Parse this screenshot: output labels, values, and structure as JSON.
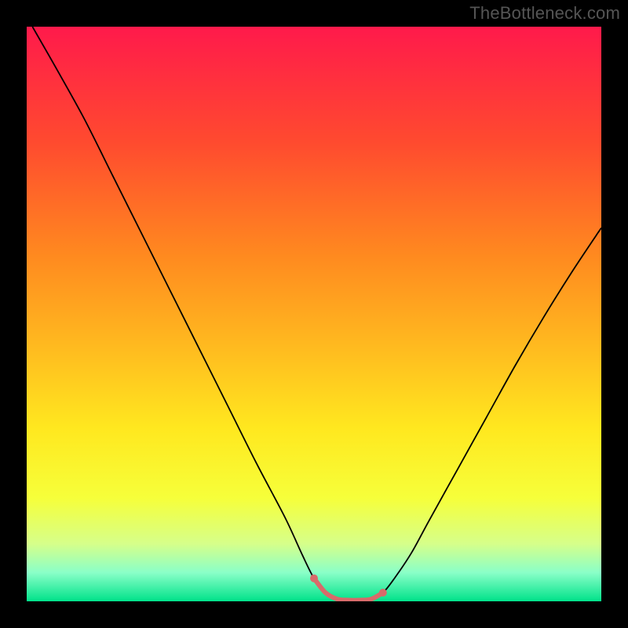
{
  "watermark": "TheBottleneck.com",
  "chart_data": {
    "type": "line",
    "title": "",
    "xlabel": "",
    "ylabel": "",
    "xlim": [
      0,
      100
    ],
    "ylim": [
      0,
      100
    ],
    "gradient_stops": [
      {
        "offset": 0,
        "color": "#ff1a4b"
      },
      {
        "offset": 20,
        "color": "#ff4a2f"
      },
      {
        "offset": 40,
        "color": "#ff8a1f"
      },
      {
        "offset": 55,
        "color": "#ffb81f"
      },
      {
        "offset": 70,
        "color": "#ffe81f"
      },
      {
        "offset": 82,
        "color": "#f6ff3a"
      },
      {
        "offset": 90,
        "color": "#d6ff8a"
      },
      {
        "offset": 95,
        "color": "#8affc8"
      },
      {
        "offset": 100,
        "color": "#00e28a"
      }
    ],
    "series": [
      {
        "name": "bottleneck-curve",
        "stroke": "#000000",
        "points": [
          {
            "x": 1.0,
            "y": 100.0
          },
          {
            "x": 5.0,
            "y": 93.0
          },
          {
            "x": 10.0,
            "y": 84.0
          },
          {
            "x": 15.0,
            "y": 74.0
          },
          {
            "x": 20.0,
            "y": 64.0
          },
          {
            "x": 25.0,
            "y": 54.0
          },
          {
            "x": 30.0,
            "y": 44.0
          },
          {
            "x": 35.0,
            "y": 34.0
          },
          {
            "x": 40.0,
            "y": 24.0
          },
          {
            "x": 45.0,
            "y": 14.5
          },
          {
            "x": 48.0,
            "y": 8.0
          },
          {
            "x": 50.0,
            "y": 4.0
          },
          {
            "x": 52.0,
            "y": 1.5
          },
          {
            "x": 54.0,
            "y": 0.4
          },
          {
            "x": 56.0,
            "y": 0.2
          },
          {
            "x": 58.0,
            "y": 0.2
          },
          {
            "x": 60.0,
            "y": 0.4
          },
          {
            "x": 62.0,
            "y": 1.5
          },
          {
            "x": 64.0,
            "y": 4.0
          },
          {
            "x": 67.0,
            "y": 8.5
          },
          {
            "x": 70.0,
            "y": 14.0
          },
          {
            "x": 75.0,
            "y": 23.0
          },
          {
            "x": 80.0,
            "y": 32.0
          },
          {
            "x": 85.0,
            "y": 41.0
          },
          {
            "x": 90.0,
            "y": 49.5
          },
          {
            "x": 95.0,
            "y": 57.5
          },
          {
            "x": 100.0,
            "y": 65.0
          }
        ]
      },
      {
        "name": "optimal-range-marker",
        "stroke": "#d86a6a",
        "stroke_width": 6,
        "points": [
          {
            "x": 50.0,
            "y": 4.0
          },
          {
            "x": 52.0,
            "y": 1.5
          },
          {
            "x": 54.0,
            "y": 0.4
          },
          {
            "x": 56.0,
            "y": 0.2
          },
          {
            "x": 58.0,
            "y": 0.2
          },
          {
            "x": 60.0,
            "y": 0.4
          },
          {
            "x": 62.0,
            "y": 1.5
          }
        ],
        "endpoints": [
          {
            "x": 50.0,
            "y": 4.0
          },
          {
            "x": 62.0,
            "y": 1.5
          }
        ]
      }
    ]
  }
}
